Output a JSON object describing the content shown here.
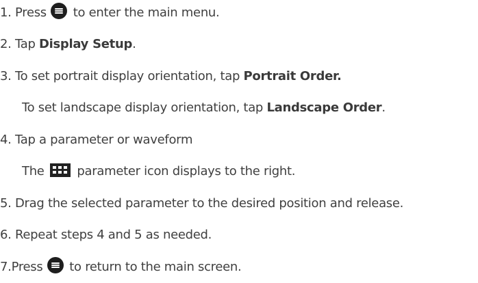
{
  "steps": [
    {
      "num": "1.",
      "pre": "Press",
      "post": "to enter the main menu.",
      "icon": "menu-button-icon"
    },
    {
      "num": "2.",
      "pre": "Tap",
      "bold": "Display Setup",
      "post": "."
    },
    {
      "num": "3.",
      "pre": "To set portrait display orientation, tap",
      "bold": "Portrait Order."
    },
    {
      "sub_pre": "To set landscape display orientation, tap",
      "sub_bold": "Landscape Order",
      "sub_post": "."
    },
    {
      "num": "4.",
      "text": "Tap a parameter or waveform"
    },
    {
      "sub_pre": "The",
      "sub_post": "parameter icon displays to the right.",
      "icon": "parameter-grid-icon"
    },
    {
      "num": "5.",
      "text": "Drag the selected parameter to the desired position and release."
    },
    {
      "num": "6.",
      "text": "Repeat steps 4 and 5 as needed."
    },
    {
      "num": "7.",
      "pre": "Press",
      "post": "to return to the main screen.",
      "icon": "menu-button-icon"
    }
  ]
}
